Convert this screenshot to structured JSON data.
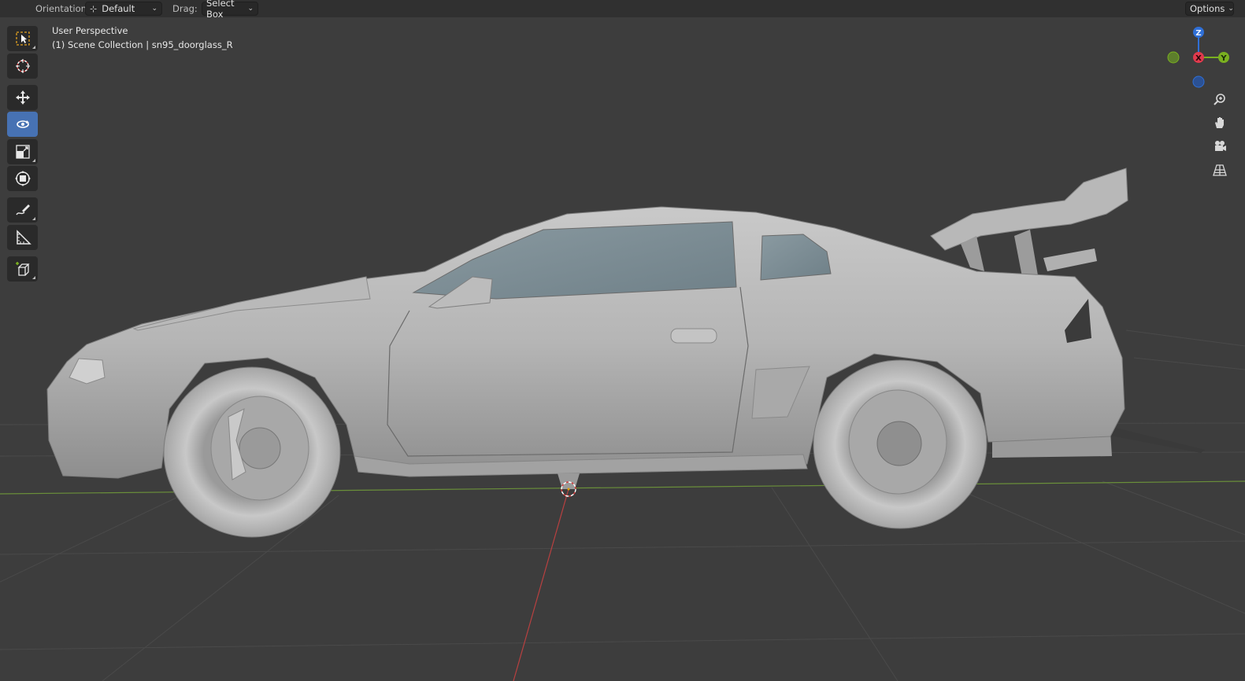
{
  "header": {
    "orientation_label": "Orientation:",
    "orientation_value": "Default",
    "drag_label": "Drag:",
    "drag_value": "Select Box",
    "options_label": "Options"
  },
  "viewport": {
    "view_name": "User Perspective",
    "collection_info": "(1) Scene Collection | sn95_doorglass_R"
  },
  "gizmo": {
    "z_label": "Z",
    "x_label": "X",
    "y_label": "Y",
    "colors": {
      "x": "#e03a4d",
      "y": "#7ab020",
      "z": "#2f6fd6"
    }
  },
  "tools": [
    {
      "name": "select-box-tool",
      "icon": "select-box-icon",
      "active": false
    },
    {
      "name": "cursor-tool",
      "icon": "cursor-icon",
      "active": false
    },
    {
      "name": "move-tool",
      "icon": "move-icon",
      "active": false
    },
    {
      "name": "rotate-tool",
      "icon": "rotate-icon",
      "active": true
    },
    {
      "name": "scale-tool",
      "icon": "scale-icon",
      "active": false
    },
    {
      "name": "transform-tool",
      "icon": "transform-icon",
      "active": false
    },
    {
      "name": "annotate-tool",
      "icon": "annotate-icon",
      "active": false
    },
    {
      "name": "measure-tool",
      "icon": "measure-icon",
      "active": false
    },
    {
      "name": "add-cube-tool",
      "icon": "add-cube-icon",
      "active": false
    }
  ],
  "nav_buttons": [
    {
      "name": "zoom-button",
      "icon": "zoom-icon"
    },
    {
      "name": "pan-button",
      "icon": "hand-icon"
    },
    {
      "name": "camera-view-button",
      "icon": "camera-icon"
    },
    {
      "name": "perspective-toggle-button",
      "icon": "grid-icon"
    }
  ]
}
